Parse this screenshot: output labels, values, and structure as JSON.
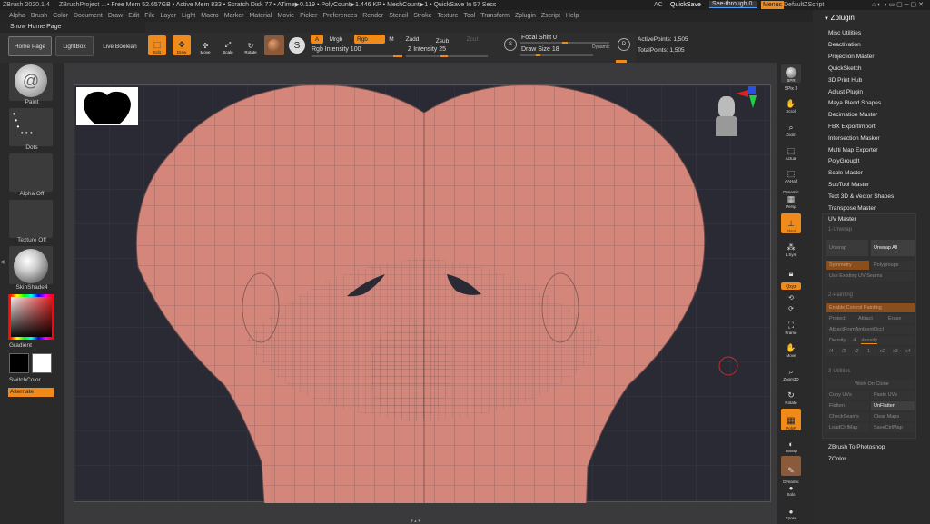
{
  "title": {
    "app": "ZBrush 2020.1.4",
    "project": "ZBrushProject ...",
    "stats": "• Free Mem 52.657GB • Active Mem 833 • Scratch Disk 77 • ATime▶0.119 • PolyCount▶1.446 KP • MeshCount▶1 • QuickSave In 57 Secs",
    "ac": "AC",
    "quicksave": "QuickSave",
    "seethrough": "See-through  0",
    "menus": "Menus",
    "script": "DefaultZScript"
  },
  "menubar": {
    "items": [
      "Alpha",
      "Brush",
      "Color",
      "Document",
      "Draw",
      "Edit",
      "File",
      "Layer",
      "Light",
      "Macro",
      "Marker",
      "Material",
      "Movie",
      "Picker",
      "Preferences",
      "Render",
      "Stencil",
      "Stroke",
      "Texture",
      "Tool",
      "Transform",
      "Zplugin",
      "Zscript",
      "Help"
    ]
  },
  "showhome": "Show Home Page",
  "topbar": {
    "homepage": "Home Page",
    "lightbox": "LightBox",
    "liveboolean": "Live Boolean",
    "edit": "Edit",
    "draw": "Draw",
    "move": "Move",
    "scale": "Scale",
    "rotate": "Rotate",
    "a": "A",
    "mrgb": "Mrgb",
    "rgb": "Rgb",
    "m": "M",
    "zadd": "Zadd",
    "zsub": "Zsub",
    "zcut": "Zcut",
    "rgb_intensity": "Rgb Intensity 100",
    "z_intensity": "Z Intensity 25",
    "focal_shift": "Focal Shift 0",
    "draw_size": "Draw Size 18",
    "dynamic": "Dynamic",
    "active_points": "ActivePoints: 1,505",
    "total_points": "TotalPoints: 1,505"
  },
  "leftshelf": {
    "brush": "Paint",
    "stroke": "Dots",
    "alpha": "Alpha Off",
    "texture": "Texture Off",
    "material": "SkinShade4",
    "gradient": "Gradient",
    "switchcolor": "SwitchColor",
    "alternate": "Alternate"
  },
  "rightshelf": {
    "bpr": "BPR",
    "spix": "SPix 3",
    "scroll": "Scroll",
    "zoom": "Zoom",
    "actual": "Actual",
    "aahalf": "AAHalf",
    "dynamic": "Dynamic",
    "persp": "Persp",
    "floor": "Floor",
    "lsym": "L.Sym",
    "lock": "",
    "xyz": "Qxyz",
    "frame": "Frame",
    "move": "Move",
    "zoom3d": "Zoom3D",
    "rotate": "Rotate",
    "polyf": "PolyF",
    "transp": "Transp",
    "dynamic2": "Dynamic",
    "solo": "Solo",
    "xpose": "Xpose"
  },
  "panel": {
    "header": "Zplugin",
    "plugins": [
      "Misc Utilities",
      "Deactivation",
      "Projection Master",
      "QuickSketch",
      "3D Print Hub",
      "Adjust Plugin",
      "Maya Blend Shapes",
      "Decimation Master",
      "FBX ExportImport",
      "Intersection Masker",
      "Multi Map Exporter",
      "PolyGroupIt",
      "Scale Master",
      "SubTool Master",
      "Text 3D & Vector Shapes",
      "Transpose Master"
    ],
    "uvmaster": {
      "title": "UV Master",
      "unwrap_section": "1-Unwrap",
      "unwrap": "Unwrap",
      "unwrap_all": "Unwrap All",
      "symmetry": "Symmetry",
      "polygroups": "Polygroups",
      "use_existing": "Use Existing UV Seams",
      "painting_section": "2-Painting",
      "enable_control": "Enable Control Painting",
      "protect": "Protect",
      "attract": "Attract",
      "erase": "Erase",
      "attract_ao": "AttractFromAmbientOccl",
      "density": "Density",
      "density_val": "4",
      "density_label": "density",
      "density_steps": [
        "/4",
        "/3",
        "/2",
        "1",
        "x2",
        "x3",
        "x4"
      ],
      "utilities_section": "3-Utilities",
      "work_on_clone": "Work On Clone",
      "copy_uvs": "Copy UVs",
      "paste_uvs": "Paste UVs",
      "flatten": "Flatten",
      "unflatten": "UnFlatten",
      "checkseams": "CheckSeams",
      "clear_maps": "Clear Maps",
      "load_ctrl": "LoadCtrlMap",
      "save_ctrl": "SaveCtrlMap"
    },
    "zbrush_to_photoshop": "ZBrush To Photoshop",
    "zcolor": "ZColor"
  },
  "colors": {
    "accent": "#f08a1a",
    "mesh_fill": "#d4867a",
    "mesh_line": "#6b4a49",
    "canvas_bg": "#2a2a34"
  }
}
